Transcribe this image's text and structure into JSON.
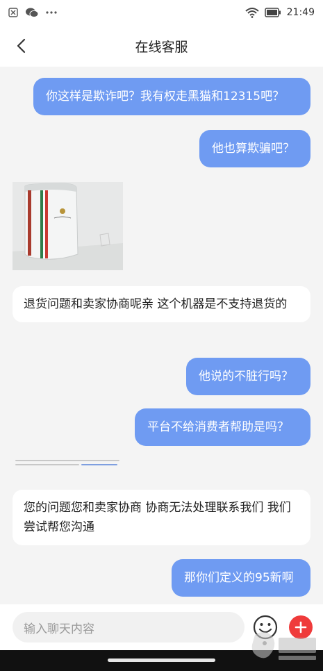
{
  "status_bar": {
    "time": "21:49",
    "left_icons": [
      "close-box-icon",
      "wechat-icon",
      "more-dots-icon"
    ],
    "right_icons": [
      "wifi-icon",
      "battery-icon"
    ]
  },
  "header": {
    "title": "在线客服"
  },
  "messages": [
    {
      "side": "out",
      "text": "你这样是欺诈吧？我有权走黑猫和12315吧？"
    },
    {
      "side": "out",
      "text": "他也算欺骗吧？"
    },
    {
      "side": "in",
      "type": "image",
      "description": "phone-photo"
    },
    {
      "side": "in",
      "text": "退货问题和卖家协商呢亲 这个机器是不支持退货的"
    },
    {
      "side": "out",
      "text": "他说的不脏行吗？"
    },
    {
      "side": "out",
      "text": "平台不给消费者帮助是吗？"
    },
    {
      "side": "in",
      "text": "您的问题您和卖家协商 协商无法处理联系我们 我们尝试帮您沟通"
    },
    {
      "side": "out",
      "text": "那你们定义的95新啊"
    }
  ],
  "input_bar": {
    "placeholder": "输入聊天内容",
    "emoji_icon": "emoji-icon",
    "plus_icon": "plus-icon"
  },
  "colors": {
    "outgoing_bubble": "#6f9bf2",
    "incoming_bubble": "#ffffff",
    "background": "#f4f4f4",
    "plus_button": "#ef3b3b"
  }
}
